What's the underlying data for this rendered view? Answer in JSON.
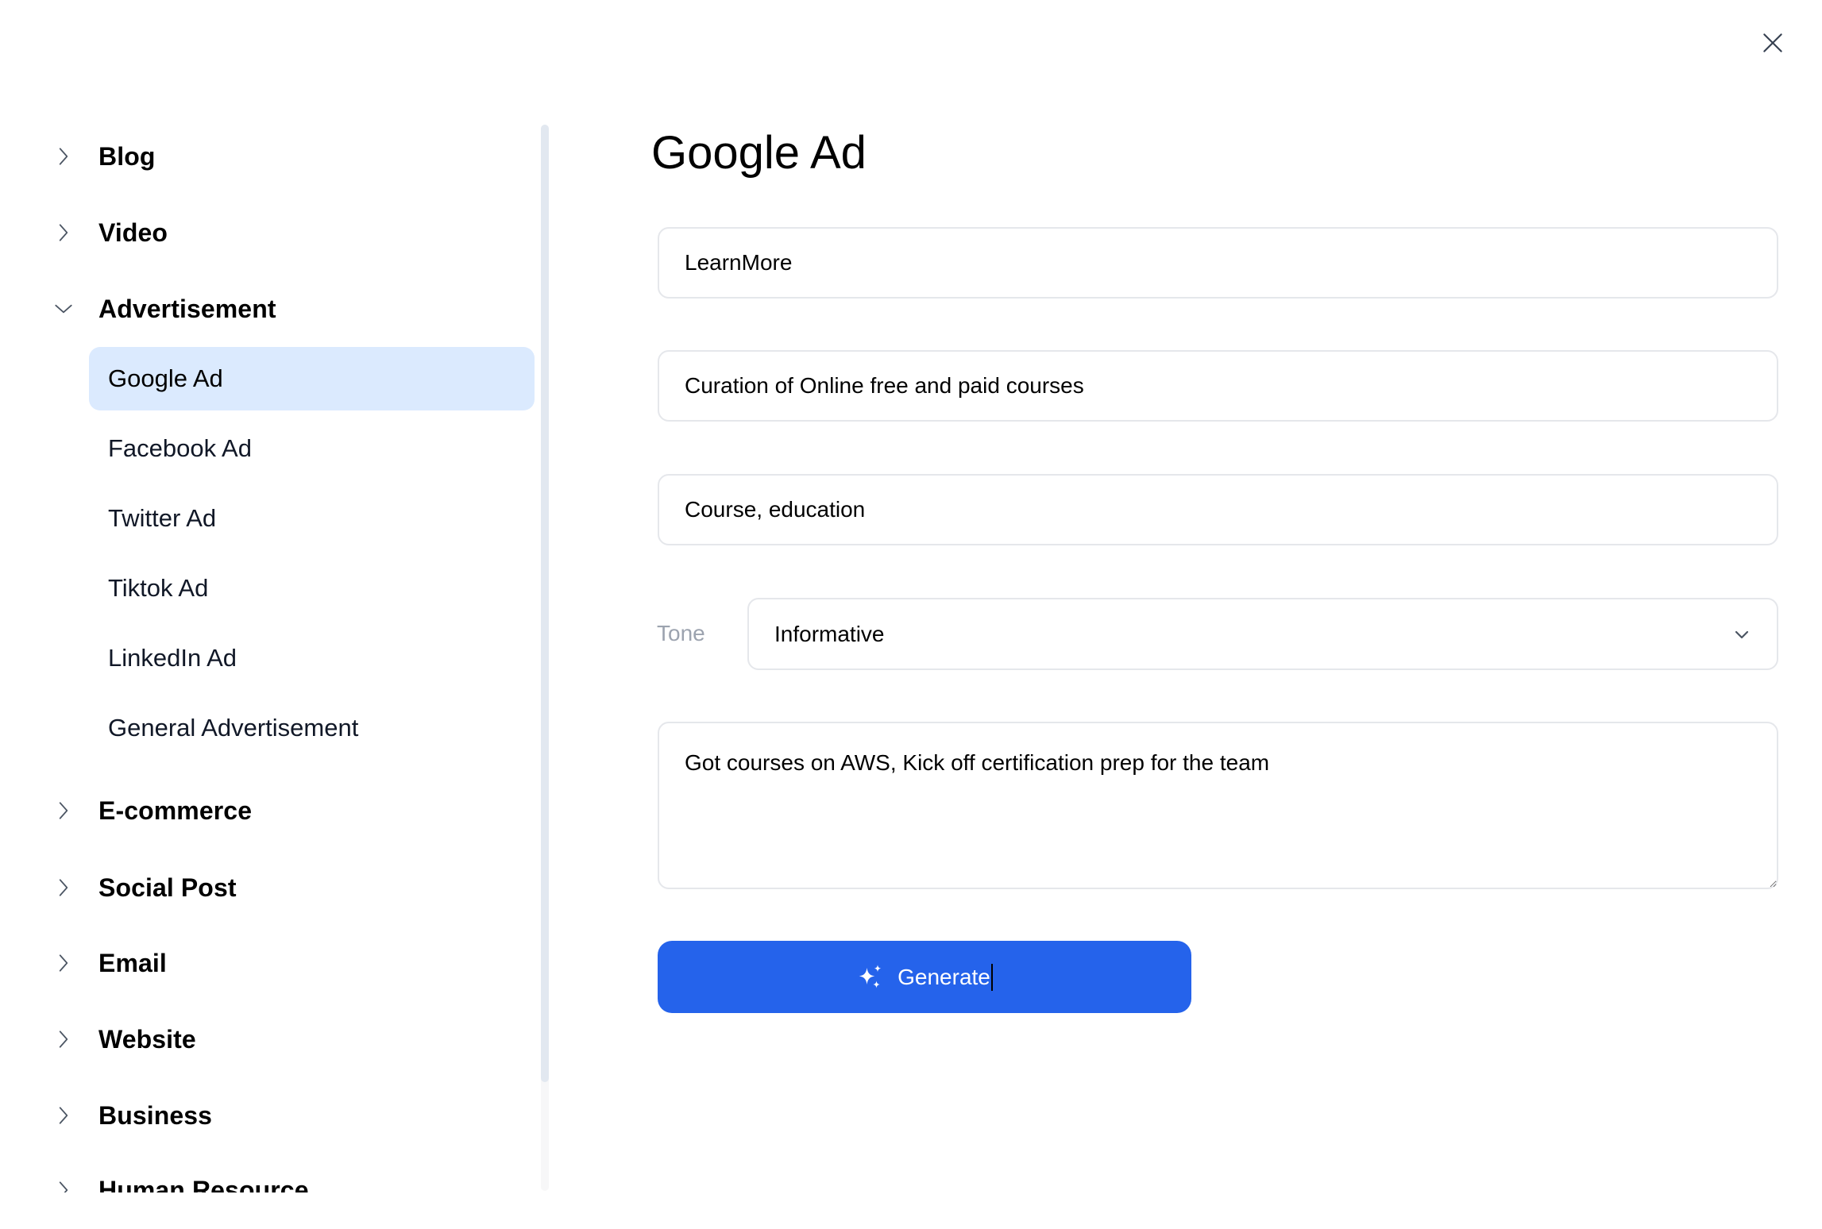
{
  "window": {
    "close_icon": "close-icon"
  },
  "sidebar": {
    "groups": [
      {
        "label": "Blog",
        "expanded": false,
        "icon": "chevron-right-icon"
      },
      {
        "label": "Video",
        "expanded": false,
        "icon": "chevron-right-icon"
      },
      {
        "label": "Advertisement",
        "expanded": true,
        "icon": "chevron-down-icon",
        "items": [
          {
            "label": "Google Ad",
            "active": true
          },
          {
            "label": "Facebook Ad",
            "active": false
          },
          {
            "label": "Twitter Ad",
            "active": false
          },
          {
            "label": "Tiktok Ad",
            "active": false
          },
          {
            "label": "LinkedIn Ad",
            "active": false
          },
          {
            "label": "General Advertisement",
            "active": false
          }
        ]
      },
      {
        "label": "E-commerce",
        "expanded": false,
        "icon": "chevron-right-icon"
      },
      {
        "label": "Social Post",
        "expanded": false,
        "icon": "chevron-right-icon"
      },
      {
        "label": "Email",
        "expanded": false,
        "icon": "chevron-right-icon"
      },
      {
        "label": "Website",
        "expanded": false,
        "icon": "chevron-right-icon"
      },
      {
        "label": "Business",
        "expanded": false,
        "icon": "chevron-right-icon"
      },
      {
        "label": "Human Resource",
        "expanded": false,
        "icon": "chevron-right-icon"
      }
    ]
  },
  "form": {
    "title": "Google Ad",
    "fields": {
      "product_name": "LearnMore",
      "description": "Curation of Online free and paid courses",
      "keywords": "Course, education"
    },
    "tone": {
      "label": "Tone",
      "selected": "Informative"
    },
    "details": "Got courses on AWS, Kick off certification prep for the team",
    "generate_label": "Generate"
  },
  "colors": {
    "accent": "#2563eb",
    "active_item_bg": "#dbeafe",
    "border": "#e5e7eb",
    "muted_text": "#9ca3af"
  }
}
